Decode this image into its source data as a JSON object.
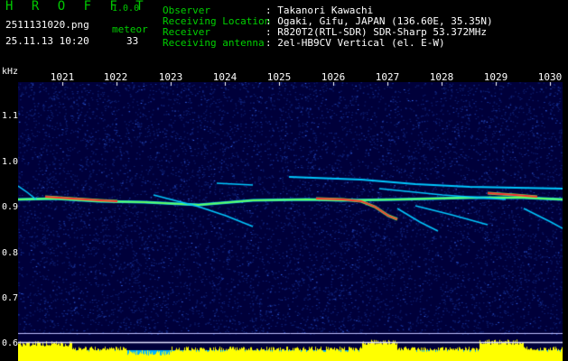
{
  "app": {
    "name": "H R O F F T",
    "version": "1.0.0"
  },
  "capture": {
    "filename": "2511131020.png",
    "datetime": "25.11.13 10:20",
    "meteor_label": "meteor",
    "meteor_count": "33"
  },
  "info": {
    "observer_label": "Observer",
    "observer_value": ": Takanori Kawachi",
    "location_label": "Receiving Location",
    "location_value": ": Ogaki, Gifu, JAPAN (136.60E, 35.35N)",
    "receiver_label": "Receiver",
    "receiver_value": ": R820T2(RTL-SDR) SDR-Sharp 53.372MHz",
    "antenna_label": "Receiving antenna",
    "antenna_value": ": 2el-HB9CV Vertical (el. E-W)"
  },
  "axis": {
    "y_unit": "kHz",
    "x_ticks": [
      "1021",
      "1022",
      "1023",
      "1024",
      "1025",
      "1026",
      "1027",
      "1028",
      "1029",
      "1030"
    ],
    "y_ticks": [
      "1.1",
      "1.0",
      "0.9",
      "0.8",
      "0.7",
      "0.6"
    ]
  },
  "colors": {
    "background": "#00003a",
    "noise": "#1a3aa0",
    "signal_low": "#00c8ff",
    "signal_mid": "#60ff60",
    "signal_high": "#ff3030",
    "spectrum": "#ffff00",
    "spectrum_base": "#00b4ff",
    "header_green": "#00d000"
  }
}
